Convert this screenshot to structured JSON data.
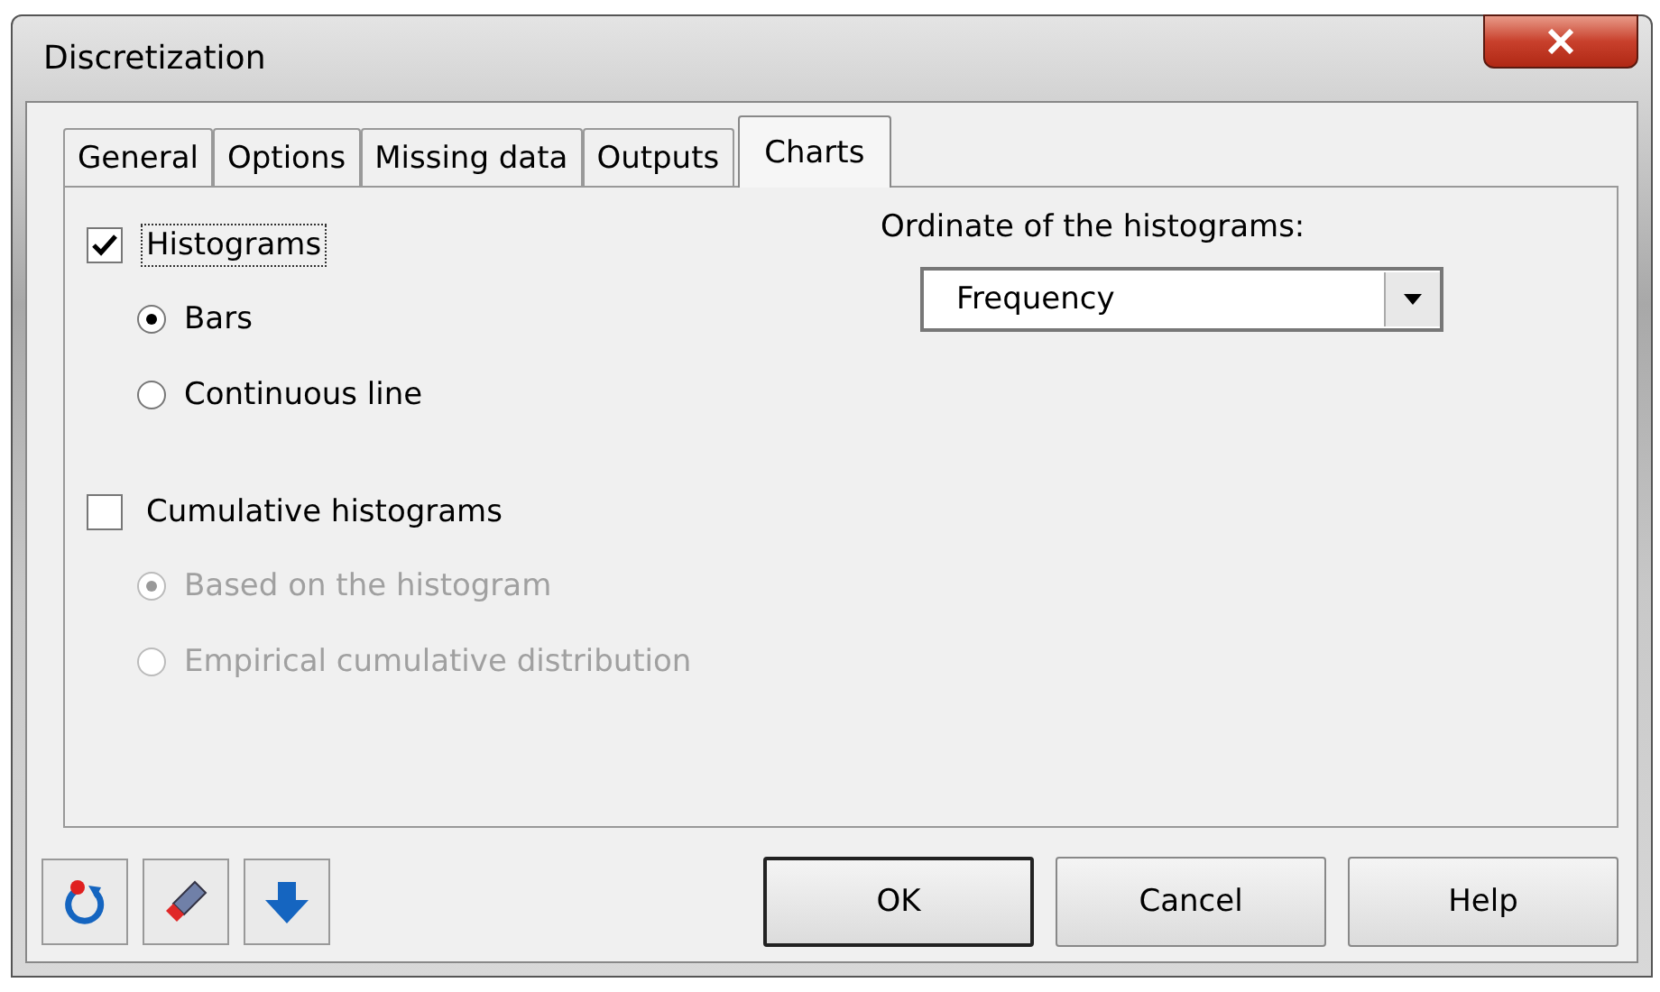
{
  "window": {
    "title": "Discretization"
  },
  "tabs": [
    {
      "label": "General",
      "selected": false
    },
    {
      "label": "Options",
      "selected": false
    },
    {
      "label": "Missing data",
      "selected": false
    },
    {
      "label": "Outputs",
      "selected": false
    },
    {
      "label": "Charts",
      "selected": true
    }
  ],
  "options": [
    {
      "kind": "checkbox",
      "label": "Histograms",
      "checked": true,
      "focused": true,
      "children": [
        {
          "kind": "radio",
          "label": "Bars",
          "selected": true,
          "disabled": false
        },
        {
          "kind": "radio",
          "label": "Continuous line",
          "selected": false,
          "disabled": false
        }
      ]
    },
    {
      "kind": "checkbox",
      "label": "Cumulative histograms",
      "checked": false,
      "focused": false,
      "children": [
        {
          "kind": "radio",
          "label": "Based on the histogram",
          "selected": true,
          "disabled": true
        },
        {
          "kind": "radio",
          "label": "Empirical cumulative distribution",
          "selected": false,
          "disabled": true
        }
      ]
    }
  ],
  "ordinate": {
    "label": "Ordinate of the histograms:",
    "value": "Frequency"
  },
  "toolbar": [
    {
      "kind": "reset"
    },
    {
      "kind": "eraser"
    },
    {
      "kind": "down"
    }
  ],
  "buttons": [
    {
      "label": "OK",
      "default": true
    },
    {
      "label": "Cancel",
      "default": false
    },
    {
      "label": "Help",
      "default": false
    }
  ]
}
